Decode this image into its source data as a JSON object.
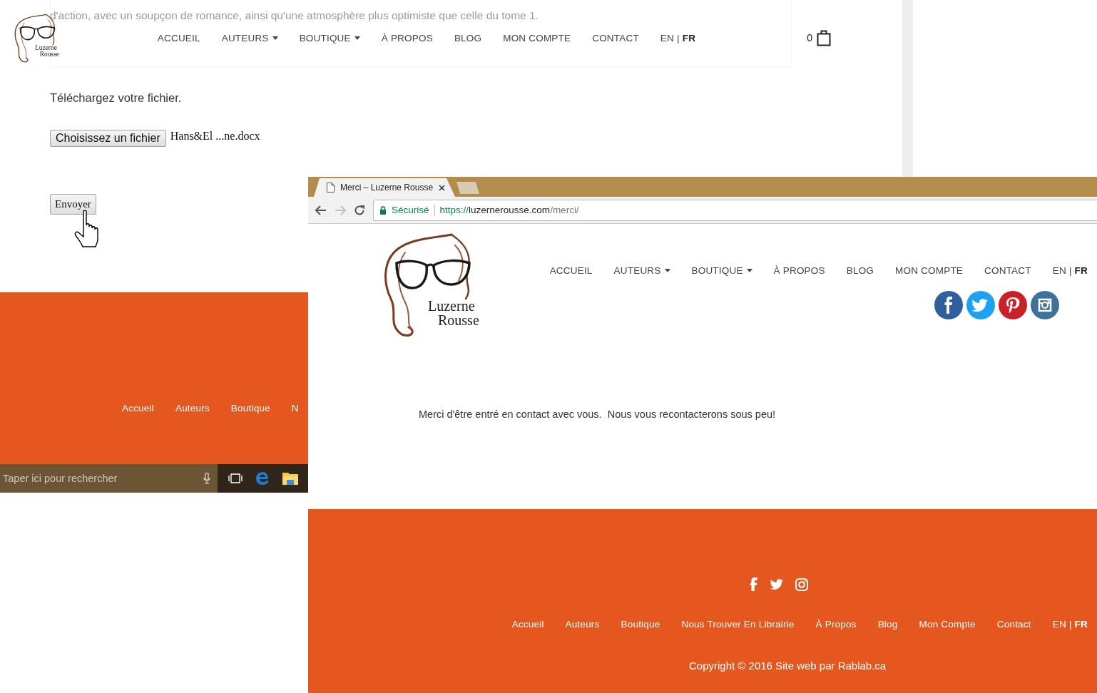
{
  "background_page": {
    "intro_text": "d'action, avec un soupçon de romance, ainsi qu'une atmosphère plus optimiste que celle du tome 1.",
    "logo_text": [
      "Luzerne",
      "Rousse"
    ],
    "nav": [
      {
        "label": "ACCUEIL",
        "has_menu": false
      },
      {
        "label": "AUTEURS",
        "has_menu": true
      },
      {
        "label": "BOUTIQUE",
        "has_menu": true
      },
      {
        "label": "À PROPOS",
        "has_menu": false
      },
      {
        "label": "BLOG",
        "has_menu": false
      },
      {
        "label": "MON COMPTE",
        "has_menu": false
      },
      {
        "label": "CONTACT",
        "has_menu": false
      }
    ],
    "languages": [
      {
        "label": "EN",
        "selected": false
      },
      {
        "label": "FR",
        "selected": true
      }
    ],
    "language_separator": "|",
    "cart_count": "0",
    "upload_label": "Téléchargez votre fichier.",
    "file_button": "Choisissez un fichier",
    "file_name": "Hans&El ...ne.docx",
    "submit_button": "Envoyer",
    "footer_nav": [
      "Accueil",
      "Auteurs",
      "Boutique",
      "N"
    ],
    "taskbar": {
      "search_placeholder": "Taper ici pour rechercher"
    }
  },
  "browser": {
    "tab_title": "Merci – Luzerne Rousse",
    "security_label": "Sécurisé",
    "url": {
      "scheme": "https://",
      "host": "luzernerousse.com",
      "path": "/merci/"
    },
    "page": {
      "logo_text": [
        "Luzerne",
        "Rousse"
      ],
      "nav": [
        {
          "label": "ACCUEIL",
          "has_menu": false
        },
        {
          "label": "AUTEURS",
          "has_menu": true
        },
        {
          "label": "BOUTIQUE",
          "has_menu": true
        },
        {
          "label": "À PROPOS",
          "has_menu": false
        },
        {
          "label": "BLOG",
          "has_menu": false
        },
        {
          "label": "MON COMPTE",
          "has_menu": false
        },
        {
          "label": "CONTACT",
          "has_menu": false
        }
      ],
      "languages": [
        {
          "label": "EN",
          "selected": false
        },
        {
          "label": "FR",
          "selected": true
        }
      ],
      "language_separator": "|",
      "message": "Merci d'être entré en contact avec vous.  Nous vous recontacterons sous peu!",
      "footer": {
        "nav": [
          "Accueil",
          "Auteurs",
          "Boutique",
          "Nous Trouver En Librairie",
          "À Propos",
          "Blog",
          "Mon Compte",
          "Contact"
        ],
        "languages": [
          {
            "label": "EN",
            "selected": false
          },
          {
            "label": "FR",
            "selected": true
          }
        ],
        "language_separator": "|",
        "copyright": "Copyright © 2016 Site web par Rablab.ca"
      }
    }
  }
}
